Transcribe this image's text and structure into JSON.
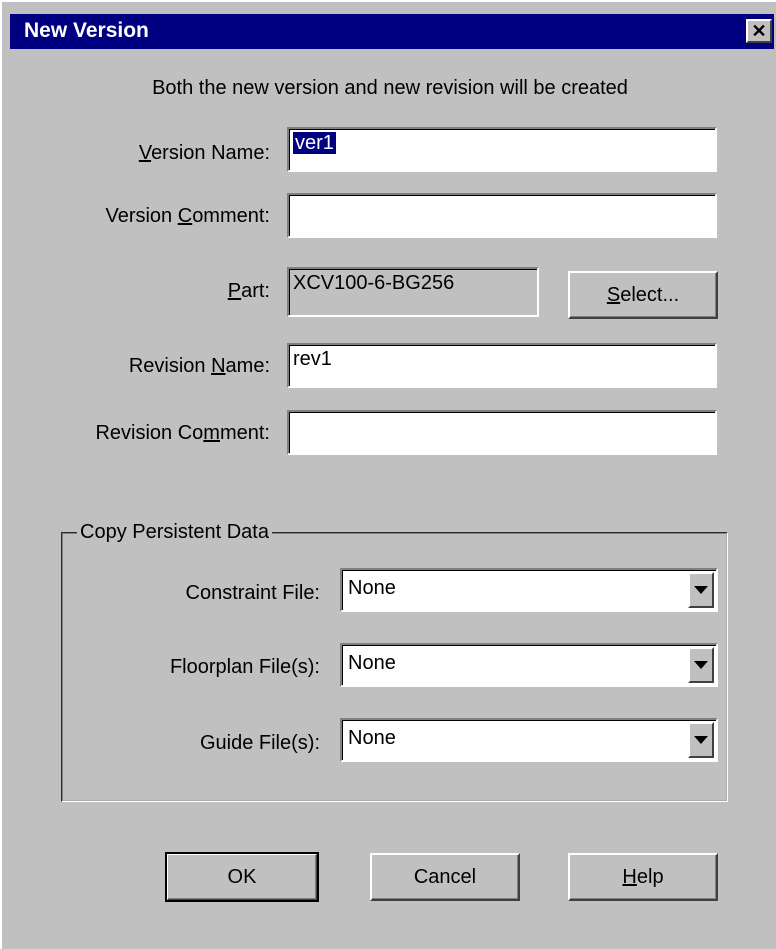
{
  "window": {
    "title": "New Version",
    "close_glyph": "✕"
  },
  "subtitle": "Both the new version and new revision will be created",
  "fields": {
    "version_name": {
      "label_pre": "",
      "label_key": "V",
      "label_post": "ersion Name:",
      "value_selected": "ver1"
    },
    "version_comment": {
      "label_pre": "Version ",
      "label_key": "C",
      "label_post": "omment:",
      "value": ""
    },
    "part": {
      "label_pre": "",
      "label_key": "P",
      "label_post": "art:",
      "value": "XCV100-6-BG256"
    },
    "revision_name": {
      "label_pre": "Revision ",
      "label_key": "N",
      "label_post": "ame:",
      "value": "rev1"
    },
    "revision_comment": {
      "label_pre": "Revision Co",
      "label_key": "m",
      "label_post": "ment:",
      "value": ""
    }
  },
  "select_button": {
    "key": "S",
    "rest": "elect..."
  },
  "persistent": {
    "group_label": "Copy Persistent Data",
    "constraint_label": "Constraint File:",
    "constraint_value": "None",
    "floorplan_label": "Floorplan File(s):",
    "floorplan_value": "None",
    "guide_label": "Guide File(s):",
    "guide_value": "None"
  },
  "buttons": {
    "ok": "OK",
    "cancel": "Cancel",
    "help_key": "H",
    "help_rest": "elp"
  }
}
